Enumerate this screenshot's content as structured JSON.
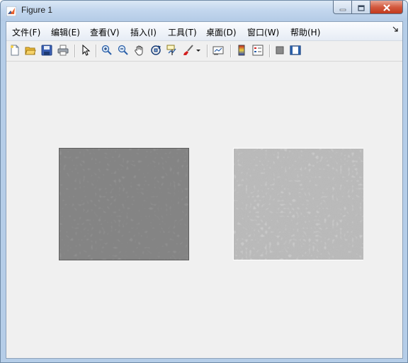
{
  "window": {
    "title": "Figure 1",
    "icon": "matlab-icon",
    "controls": [
      "minimize-icon",
      "maximize-icon",
      "close-icon"
    ]
  },
  "menubar": {
    "items": [
      {
        "label": "文件(F)"
      },
      {
        "label": "编辑(E)"
      },
      {
        "label": "查看(V)"
      },
      {
        "label": "插入(I)"
      },
      {
        "label": "工具(T)"
      },
      {
        "label": "桌面(D)"
      },
      {
        "label": "窗口(W)"
      },
      {
        "label": "帮助(H)"
      }
    ],
    "overflow_icon": "dock-arrow-icon"
  },
  "toolbar": {
    "groups": [
      [
        "new-figure-icon",
        "open-file-icon",
        "save-icon",
        "print-icon"
      ],
      [
        "pointer-icon"
      ],
      [
        "zoom-in-icon",
        "zoom-out-icon",
        "pan-hand-icon",
        "rotate-3d-icon",
        "data-cursor-icon",
        "brush-icon",
        "brush-dropdown-icon"
      ],
      [
        "link-plot-icon"
      ],
      [
        "colorbar-icon",
        "legend-icon"
      ],
      [
        "hide-plot-tools-icon",
        "show-plot-tools-icon"
      ]
    ]
  },
  "figure": {
    "background": "#f0f0f0",
    "images": [
      {
        "name": "left-image-axes",
        "description_tone": "darker gray micrograph",
        "base_color": "#8e8e8e"
      },
      {
        "name": "right-image-axes",
        "description_tone": "lighter gray micrograph",
        "base_color": "#c9c9c9"
      }
    ]
  }
}
